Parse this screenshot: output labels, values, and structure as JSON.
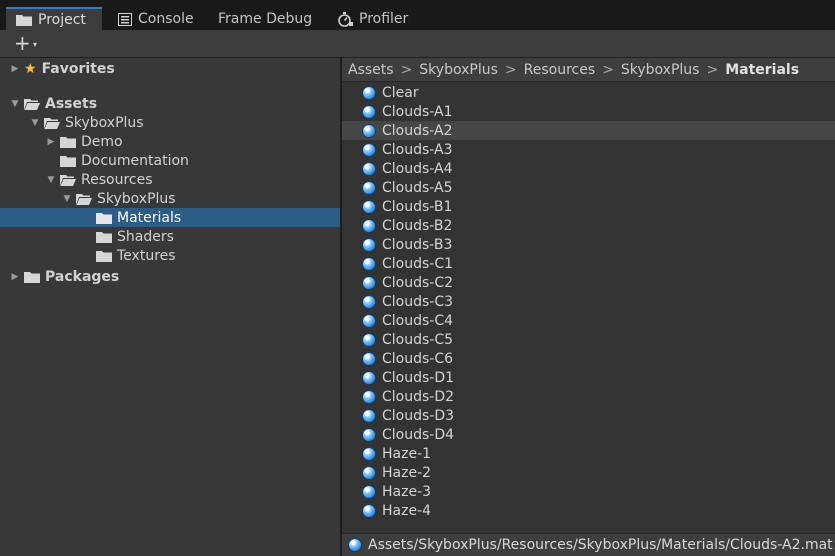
{
  "tabs": [
    {
      "label": "Project",
      "icon": "folder-icon",
      "active": true
    },
    {
      "label": "Console",
      "icon": "console-icon",
      "active": false
    },
    {
      "label": "Frame Debug",
      "icon": "",
      "active": false
    },
    {
      "label": "Profiler",
      "icon": "profiler-icon",
      "active": false
    }
  ],
  "toolbar": {
    "add_label": "+",
    "caret": "▾"
  },
  "tree": [
    {
      "label": "Favorites",
      "icon": "star-icon",
      "expanded": false,
      "bold": true
    },
    {
      "label": "Assets",
      "icon": "folder-open-icon",
      "expanded": true,
      "bold": true
    },
    {
      "label": "SkyboxPlus",
      "icon": "folder-open-icon",
      "expanded": true
    },
    {
      "label": "Demo",
      "icon": "folder-icon",
      "expanded": false
    },
    {
      "label": "Documentation",
      "icon": "folder-icon"
    },
    {
      "label": "Resources",
      "icon": "folder-open-icon",
      "expanded": true
    },
    {
      "label": "SkyboxPlus",
      "icon": "folder-open-icon",
      "expanded": true
    },
    {
      "label": "Materials",
      "icon": "folder-icon",
      "selected": true
    },
    {
      "label": "Shaders",
      "icon": "folder-icon"
    },
    {
      "label": "Textures",
      "icon": "folder-icon"
    },
    {
      "label": "Packages",
      "icon": "folder-icon",
      "expanded": false,
      "bold": true
    }
  ],
  "breadcrumb": {
    "parts": [
      "Assets",
      "SkyboxPlus",
      "Resources",
      "SkyboxPlus"
    ],
    "current": "Materials",
    "separator": ">"
  },
  "assets": [
    {
      "label": "Clear"
    },
    {
      "label": "Clouds-A1"
    },
    {
      "label": "Clouds-A2",
      "highlighted": true
    },
    {
      "label": "Clouds-A3"
    },
    {
      "label": "Clouds-A4"
    },
    {
      "label": "Clouds-A5"
    },
    {
      "label": "Clouds-B1"
    },
    {
      "label": "Clouds-B2"
    },
    {
      "label": "Clouds-B3"
    },
    {
      "label": "Clouds-C1"
    },
    {
      "label": "Clouds-C2"
    },
    {
      "label": "Clouds-C3"
    },
    {
      "label": "Clouds-C4"
    },
    {
      "label": "Clouds-C5"
    },
    {
      "label": "Clouds-C6"
    },
    {
      "label": "Clouds-D1"
    },
    {
      "label": "Clouds-D2"
    },
    {
      "label": "Clouds-D3"
    },
    {
      "label": "Clouds-D4"
    },
    {
      "label": "Haze-1"
    },
    {
      "label": "Haze-2"
    },
    {
      "label": "Haze-3"
    },
    {
      "label": "Haze-4"
    }
  ],
  "status": {
    "path": "Assets/SkyboxPlus/Resources/SkyboxPlus/Materials/Clouds-A2.mat"
  },
  "colors": {
    "selection": "#2c5d87",
    "accent": "#3a79bb",
    "material": "#2f8be0"
  }
}
